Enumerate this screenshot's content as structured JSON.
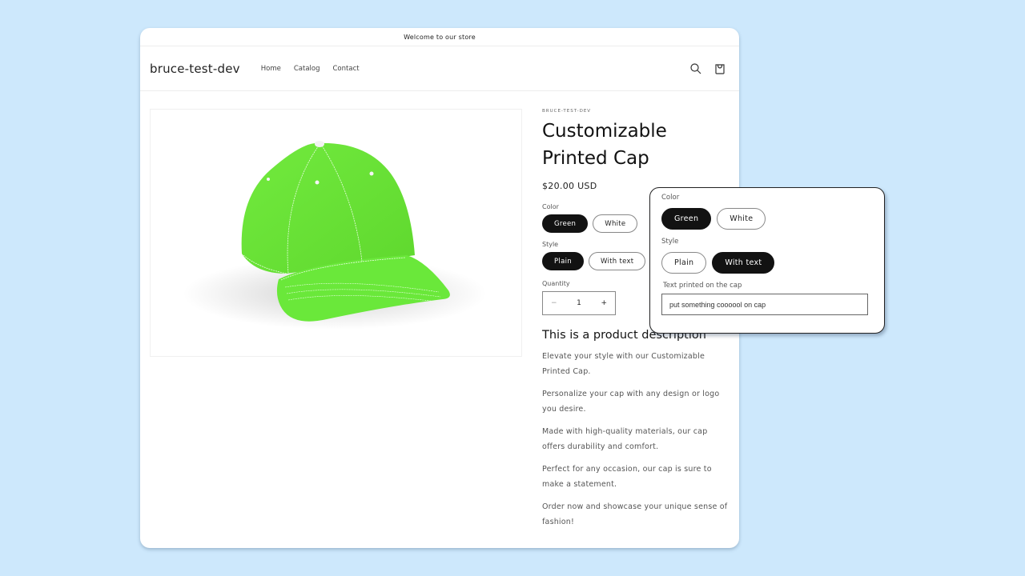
{
  "announcement": "Welcome to our store",
  "header": {
    "logo": "bruce-test-dev",
    "nav": [
      "Home",
      "Catalog",
      "Contact"
    ],
    "icons": [
      "search-icon",
      "cart-icon"
    ]
  },
  "product": {
    "vendor": "BRUCE-TEST-DEV",
    "title_line1": "Customizable",
    "title_line2": "Printed Cap",
    "price": "$20.00 USD",
    "image_alt": "Green baseball cap",
    "cap_color": "#6ee83c",
    "options": {
      "color_label": "Color",
      "color_values": [
        "Green",
        "White"
      ],
      "color_selected": "Green",
      "style_label": "Style",
      "style_values": [
        "Plain",
        "With text"
      ],
      "style_selected": "Plain"
    },
    "quantity_label": "Quantity",
    "quantity": "1",
    "qty_minus": "−",
    "qty_plus": "+",
    "description_title": "This is a product description",
    "description": [
      "Elevate your style with our Customizable Printed Cap.",
      "Personalize your cap with any design or logo you desire.",
      "Made with high-quality materials, our cap offers durability and comfort.",
      "Perfect for any occasion, our cap is sure to make a statement.",
      "Order now and showcase your unique sense of fashion!"
    ]
  },
  "popup": {
    "color_label": "Color",
    "color_values": [
      "Green",
      "White"
    ],
    "color_selected": "Green",
    "style_label": "Style",
    "style_values": [
      "Plain",
      "With text"
    ],
    "style_selected": "With text",
    "text_field_label": "Text printed on the cap",
    "text_field_value": "put something coooool on cap"
  },
  "colors": {
    "background": "#cde8fc",
    "selected_pill": "#121212"
  }
}
